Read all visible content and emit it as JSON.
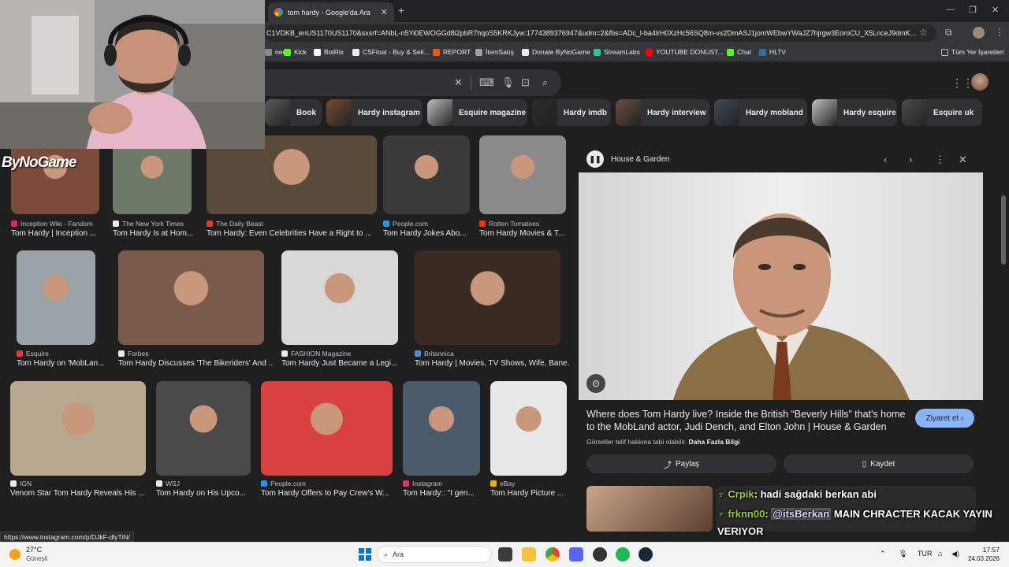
{
  "browser": {
    "tab_title": "tom hardy - Google'da Ara",
    "new_tab": "+",
    "url": "C1VDKB_enUS1170US1170&sxsrf=ANbL-n5Yi0EWOGGd8i2pbR7hqoS5KRKJyw:1774389376947&udm=2&fbs=ADc_l-ba4lrH0XzHc56SQ8m-vx2DmASJ1jomWEbwYWaJZ7hjrgw3EoroCU_X5LnceJ9dmK...",
    "bookmarks": [
      {
        "label": "nee",
        "color": "#888888"
      },
      {
        "label": "Kick",
        "color": "#53fc18"
      },
      {
        "label": "BotRix",
        "color": "#ffffff"
      },
      {
        "label": "CSFloat - Buy & Sell...",
        "color": "#e8eaed"
      },
      {
        "label": "REPORT",
        "color": "#e85d04"
      },
      {
        "label": "İtemSatış",
        "color": "#9aa0a6"
      },
      {
        "label": "Donate ByNoGame",
        "color": "#e8eaed"
      },
      {
        "label": "StreamLabs",
        "color": "#31c3a2"
      },
      {
        "label": "YOUTUBE DONUST...",
        "color": "#ff0000"
      },
      {
        "label": "Chat",
        "color": "#53fc18"
      },
      {
        "label": "HLTV",
        "color": "#2d6da3"
      }
    ],
    "all_bookmarks": "Tüm Yer İşaretleri"
  },
  "search": {
    "clear": "✕",
    "chips": [
      "Book",
      "Hardy instagram",
      "Esquire magazine",
      "Hardy imdb",
      "Hardy interview",
      "Hardy mobland",
      "Hardy esquire",
      "Esquire uk"
    ]
  },
  "results": {
    "row1": [
      {
        "source": "Inception Wiki - Fandom",
        "caption": "Tom Hardy | Inception ...",
        "icon_color": "#e91e63"
      },
      {
        "source": "The New York Times",
        "caption": "Tom Hardy Is at Hom...",
        "icon_color": "#e8eaed"
      },
      {
        "source": "The Daily Beast",
        "caption": "Tom Hardy: Even Celebrities Have a Right to ...",
        "icon_color": "#e53935"
      },
      {
        "source": "People.com",
        "caption": "Tom Hardy Jokes Abo...",
        "icon_color": "#2196f3"
      },
      {
        "source": "Rotten Tomatoes",
        "caption": "Tom Hardy Movies & T...",
        "icon_color": "#fa320a"
      }
    ],
    "row2": [
      {
        "source": "Esquire",
        "caption": "Tom Hardy on 'MobLan...",
        "icon_color": "#e53935"
      },
      {
        "source": "Forbes",
        "caption": "Tom Hardy Discusses 'The Bikeriders' And ...",
        "icon_color": "#e8eaed"
      },
      {
        "source": "FASHION Magazine",
        "caption": "Tom Hardy Just Became a Legi...",
        "icon_color": "#e8eaed"
      },
      {
        "source": "Britannica",
        "caption": "Tom Hardy | Movies, TV Shows, Wife, Bane...",
        "icon_color": "#4a90d9"
      }
    ],
    "row3": [
      {
        "source": "IGN",
        "caption": "Venom Star Tom Hardy Reveals His ...",
        "icon_color": "#e8eaed"
      },
      {
        "source": "WSJ",
        "caption": "Tom Hardy on His Upco...",
        "icon_color": "#e8eaed"
      },
      {
        "source": "People.com",
        "caption": "Tom Hardy Offers to Pay Crew's W...",
        "icon_color": "#2196f3"
      },
      {
        "source": "Instagram",
        "caption": "Tom Hardy:: \"I gen...",
        "icon_color": "#e1306c"
      },
      {
        "source": "eBay",
        "caption": "Tom Hardy Picture ...",
        "icon_color": "#f5af02"
      }
    ]
  },
  "preview": {
    "source": "House & Garden",
    "title": "Where does Tom Hardy live? Inside the British “Beverly Hills” that's home to the MobLand actor, Judi Dench, and Elton John | House & Garden",
    "visit": "Ziyaret et",
    "note": "Görseller telif hakkına tabi olabilir.",
    "note_link": "Daha Fazla Bilgi",
    "share": "Paylaş",
    "save": "Kaydet"
  },
  "overlay": {
    "logo": "ByNoGame",
    "chat": [
      {
        "user": "Crpik",
        "sep": ": ",
        "msg": "hadi sağdaki berkan abi"
      },
      {
        "user": "frknn00",
        "sep": ": ",
        "mention": "@itsBerkan",
        "msg": " MAIN CHRACTER KACAK YAYIN",
        "msg2": "VERIYOR"
      }
    ]
  },
  "status_url": "https://www.instagram.com/p/DJkF-dlyTiN/",
  "taskbar": {
    "weather_temp": "27°C",
    "weather_desc": "Güneşli",
    "search_label": "Ara",
    "lang": "TUR",
    "time": "17:57",
    "date": "24.03.2026"
  }
}
